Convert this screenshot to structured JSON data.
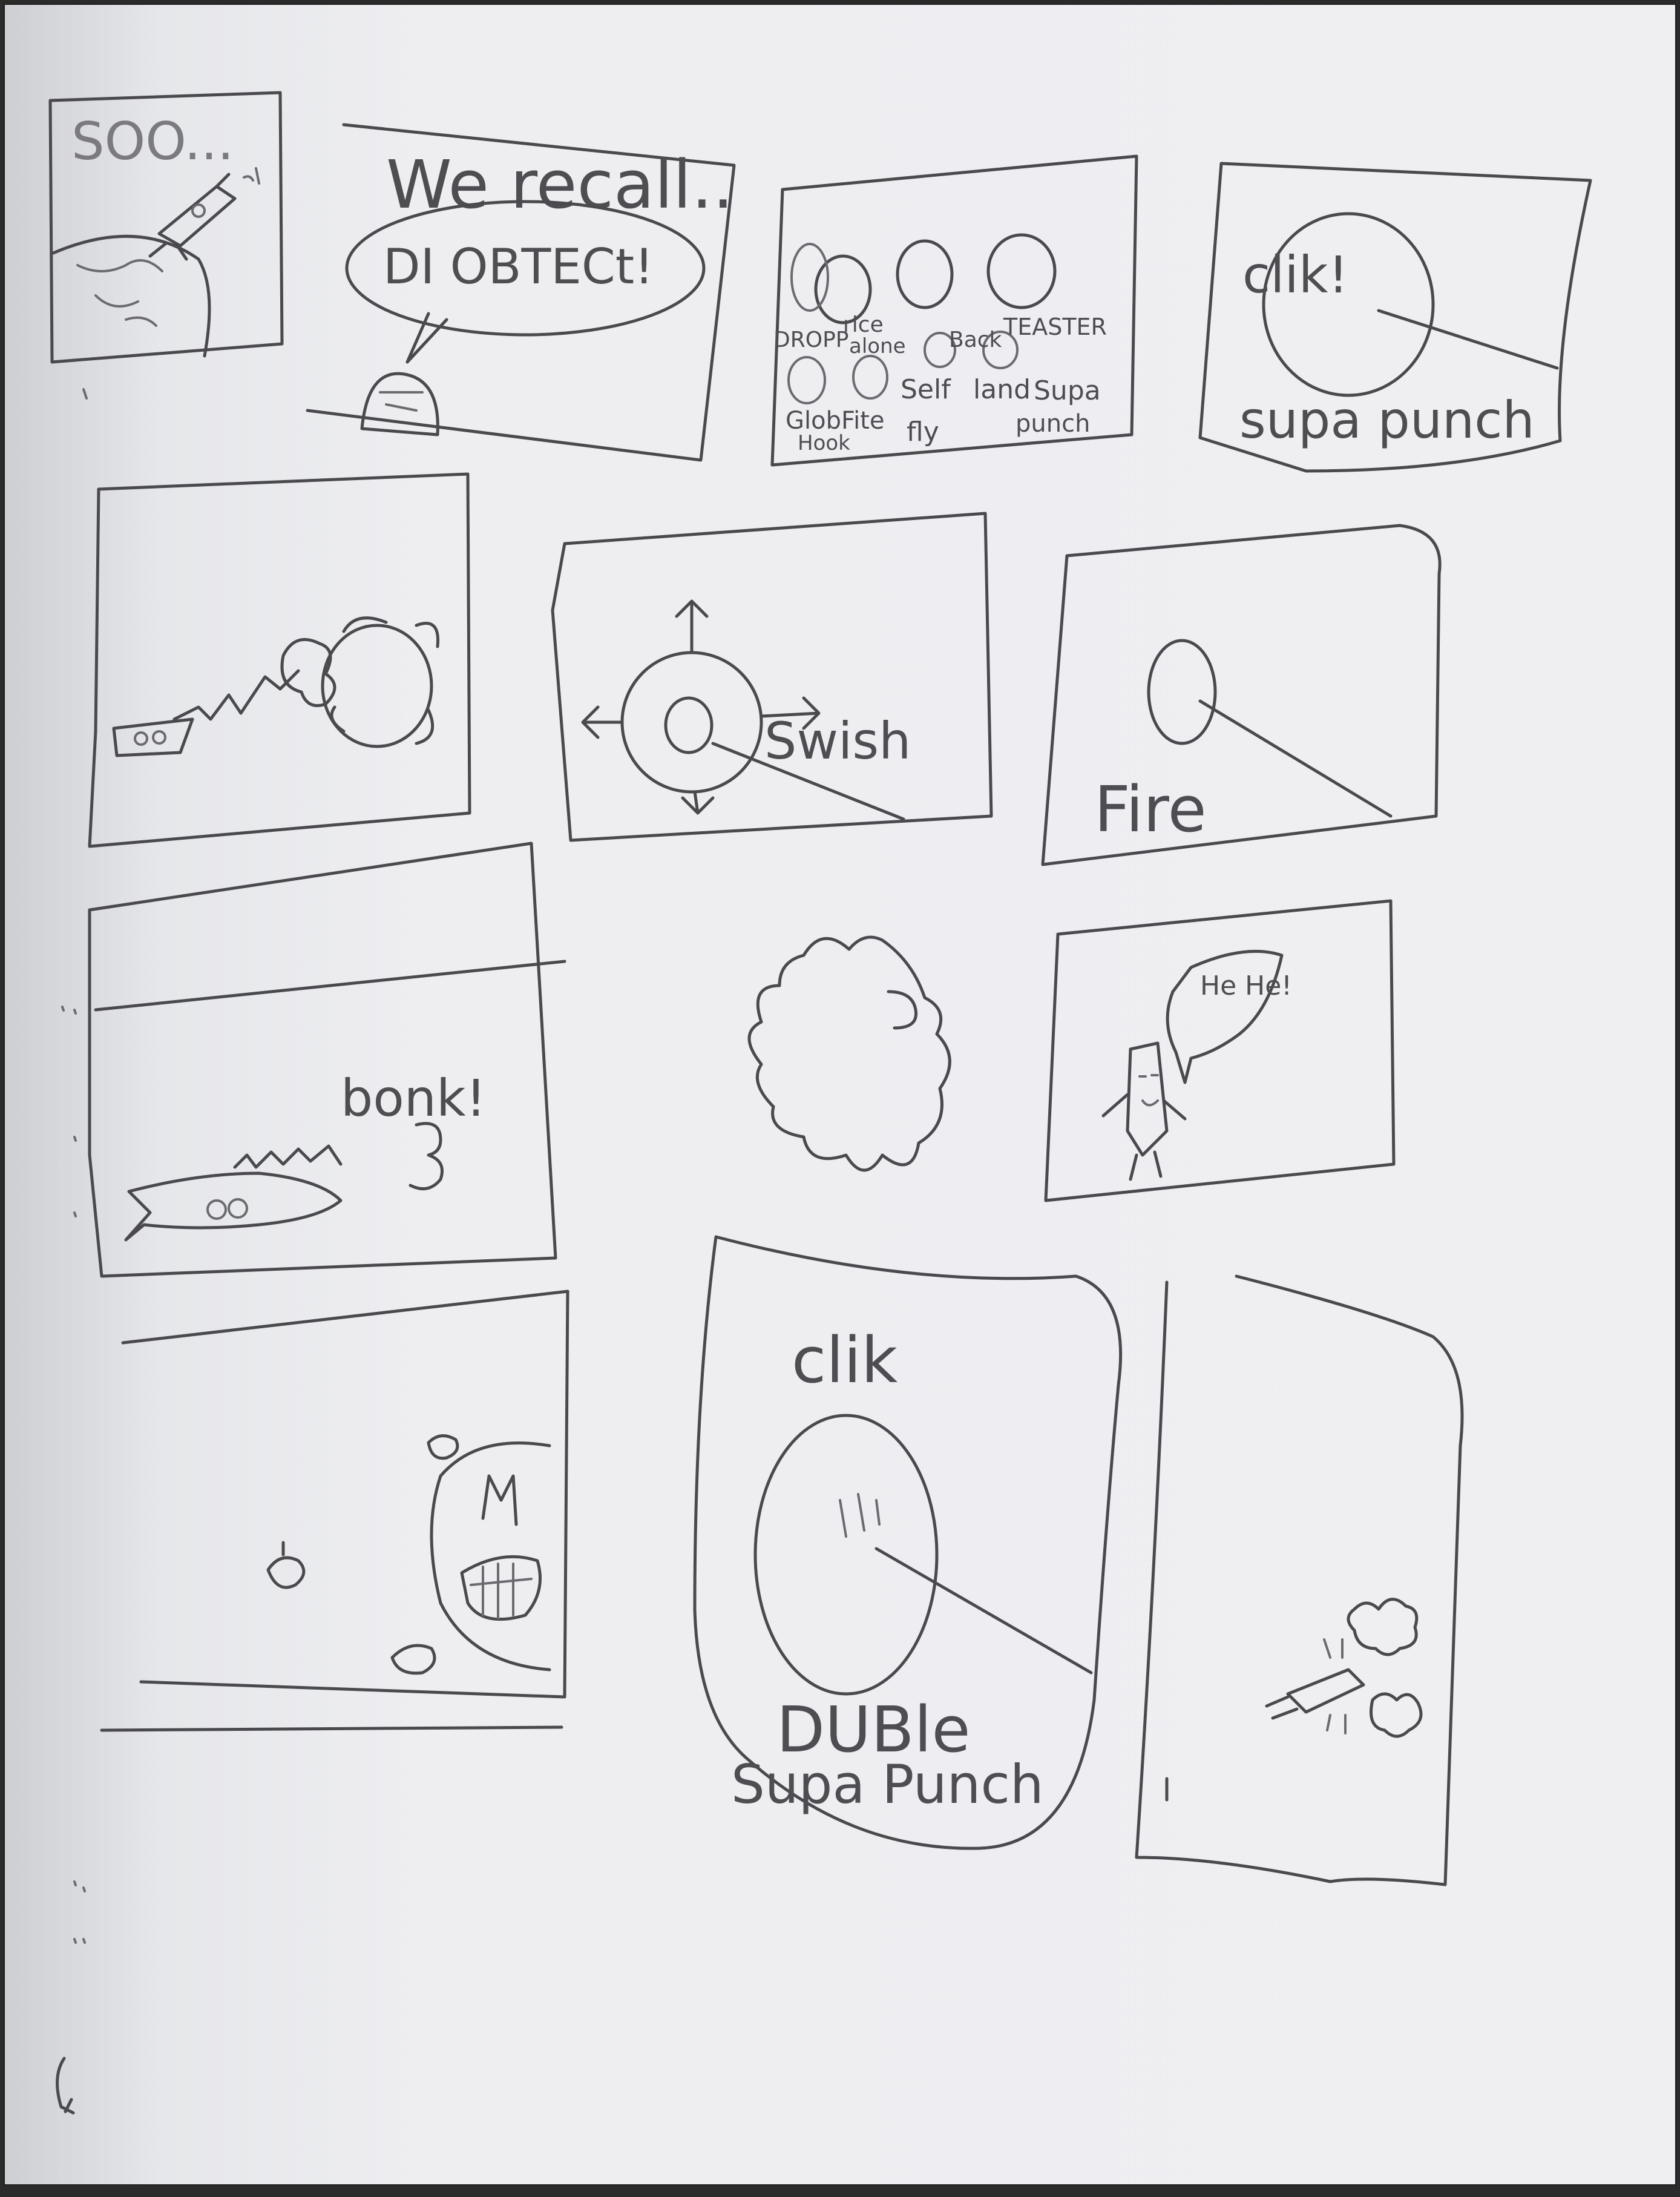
{
  "panels": {
    "p1": {
      "text": "SOO..."
    },
    "p2": {
      "text_top": "We recall..",
      "text_bubble": "DI OBTECt!"
    },
    "p3": {
      "labels": [
        "DROPP",
        "rice",
        "alone",
        "Back",
        "TEASTER"
      ],
      "row2": [
        "Self",
        "land",
        "Supa"
      ],
      "row3": [
        "GlobFite",
        "fly",
        "punch"
      ],
      "row4": [
        "Hook"
      ]
    },
    "p4": {
      "sound": "clik!",
      "caption": "supa punch"
    },
    "p6": {
      "sound": "Swish"
    },
    "p7": {
      "sound": "Fire"
    },
    "p8": {
      "sound": "bonk!"
    },
    "p10": {
      "speech": "He He!"
    },
    "p12": {
      "sound": "clik",
      "caption_line1": "DUBle",
      "caption_line2": "Supa Punch"
    }
  }
}
